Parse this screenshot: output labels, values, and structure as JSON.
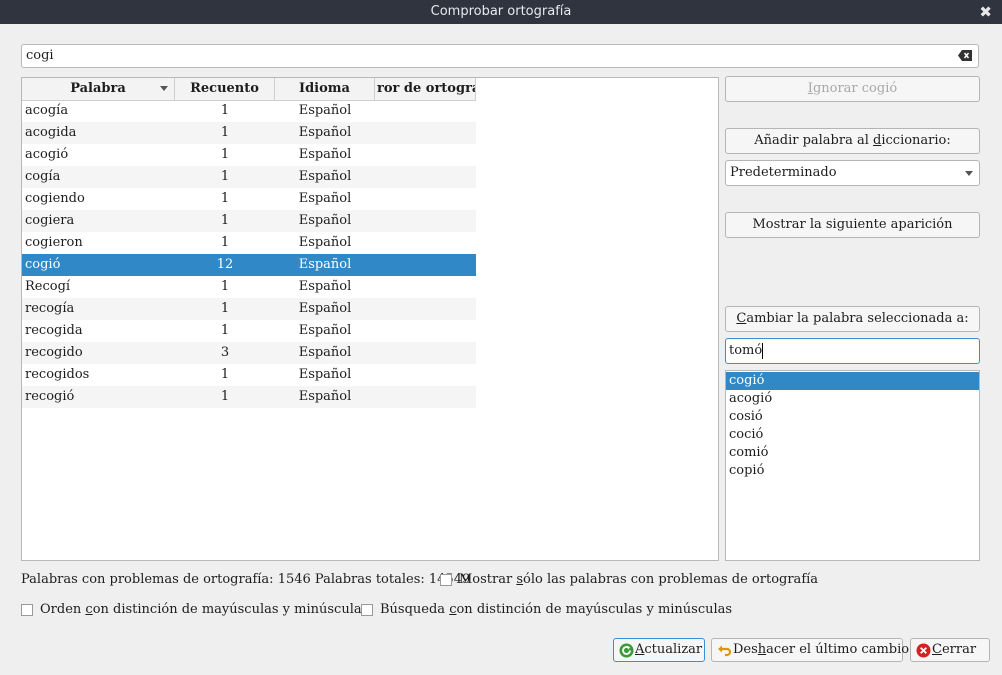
{
  "window": {
    "title": "Comprobar ortografía"
  },
  "search": {
    "value": "cogi"
  },
  "table": {
    "headers": {
      "word": "Palabra",
      "count": "Recuento",
      "language": "Idioma",
      "error": "ror de ortografía"
    },
    "rows": [
      {
        "word": "acogía",
        "count": "1",
        "language": "Español"
      },
      {
        "word": "acogida",
        "count": "1",
        "language": "Español"
      },
      {
        "word": "acogió",
        "count": "1",
        "language": "Español"
      },
      {
        "word": "cogía",
        "count": "1",
        "language": "Español"
      },
      {
        "word": "cogiendo",
        "count": "1",
        "language": "Español"
      },
      {
        "word": "cogiera",
        "count": "1",
        "language": "Español"
      },
      {
        "word": "cogieron",
        "count": "1",
        "language": "Español"
      },
      {
        "word": "cogió",
        "count": "12",
        "language": "Español"
      },
      {
        "word": "Recogí",
        "count": "1",
        "language": "Español"
      },
      {
        "word": "recogía",
        "count": "1",
        "language": "Español"
      },
      {
        "word": "recogida",
        "count": "1",
        "language": "Español"
      },
      {
        "word": "recogido",
        "count": "3",
        "language": "Español"
      },
      {
        "word": "recogidos",
        "count": "1",
        "language": "Español"
      },
      {
        "word": "recogió",
        "count": "1",
        "language": "Español"
      }
    ]
  },
  "actions": {
    "ignore_pre": "",
    "ignore_u": "I",
    "ignore_post": "gnorar cogió",
    "add_pre": "Añadir palabra al ",
    "add_u": "d",
    "add_post": "iccionario:",
    "dictionary": "Predeterminado",
    "show_next": "Mostrar la siguiente aparición",
    "change_pre": "",
    "change_u": "C",
    "change_post": "ambiar la palabra seleccionada a:",
    "replacement": "tomó"
  },
  "suggestions": [
    "cogió",
    "acogió",
    "cosió",
    "coció",
    "comió",
    "copió"
  ],
  "stats": {
    "text": "Palabras con problemas de ortografía: 1546 Palabras totales: 14549"
  },
  "options": {
    "only_misspelled_pre": "Mostrar ",
    "only_misspelled_u": "s",
    "only_misspelled_post": "ólo las palabras con problemas de ortografía",
    "case_sort_pre": "Orden ",
    "case_sort_u": "c",
    "case_sort_post": "on distinción de mayúsculas y minúsculas",
    "case_search_pre": "Búsqueda ",
    "case_search_u": "c",
    "case_search_post": "on distinción de mayúsculas y minúsculas"
  },
  "footer": {
    "refresh_u": "A",
    "refresh_post": "ctualizar",
    "undo_pre": "Des",
    "undo_u": "h",
    "undo_post": "acer el último cambio",
    "close_pre": "",
    "close_u": "C",
    "close_post": "errar"
  },
  "colors": {
    "selection": "#3088c6",
    "titlebar": "#2f343f",
    "focus": "#3b8ed8"
  }
}
